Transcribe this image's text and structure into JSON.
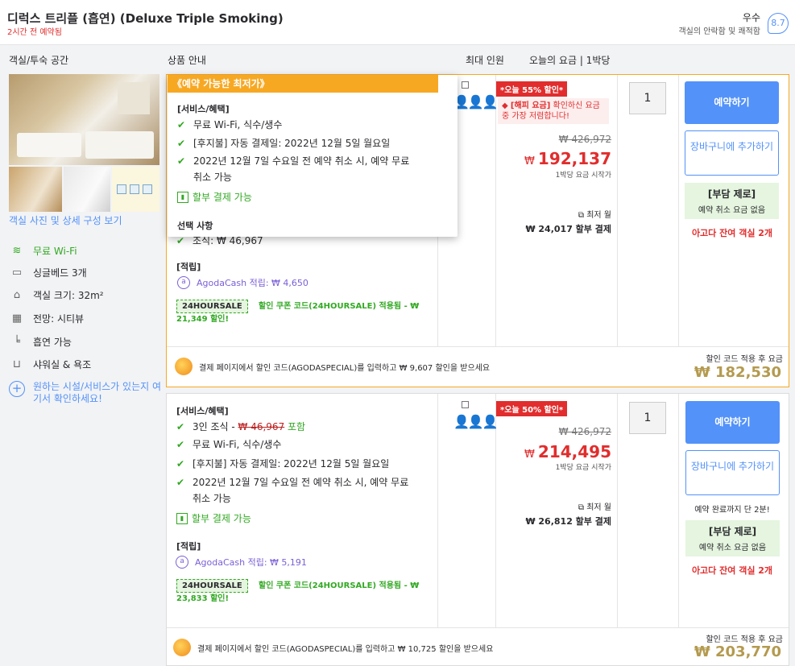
{
  "header": {
    "title": "디럭스 트리플 (흡연) (Deluxe Triple Smoking)",
    "booked_ago": "2시간 전 예약됨",
    "rating_word": "우수",
    "rating_sub": "객실의 안락함 및 쾌적함",
    "rating_score": "8.7"
  },
  "columns": {
    "room": "객실/투숙 공간",
    "info": "상품 안내",
    "occupancy": "최대 인원",
    "price": "오늘의 요금 | 1박당"
  },
  "left": {
    "photo_link": "객실 사진 및 상세 구성 보기",
    "amenities": [
      {
        "icon": "wifi-icon",
        "label": "무료 Wi-Fi"
      },
      {
        "icon": "bed-icon",
        "label": "싱글베드 3개"
      },
      {
        "icon": "room-size-icon",
        "label": "객실 크기: 32m²"
      },
      {
        "icon": "city-view-icon",
        "label": "전망: 시티뷰"
      },
      {
        "icon": "smoking-icon",
        "label": "흡연 가능"
      },
      {
        "icon": "bath-icon",
        "label": "샤워실 & 욕조"
      }
    ],
    "more_link": "원하는 시설/서비스가 있는지 여기서 확인하세요!"
  },
  "offer1": {
    "popover_title": "《예약 가능한 최저가》",
    "benefits_label": "[서비스/혜택]",
    "benefits": [
      "무료 Wi-Fi, 식수/생수",
      "[후지불] 자동 결제일: 2022년 12월 5일 월요일",
      "2022년 12월 7일 수요일 전 예약 취소 시, 예약 무료 취소 가능"
    ],
    "installment": "할부 결제 가능",
    "options_label": "선택 사항",
    "option_breakfast": "조식: ₩ 46,967",
    "points_label": "[적립]",
    "agodacash": "AgodaCash 적립: ₩ 4,650",
    "coupon_code": "24HOURSALE",
    "coupon_desc": "할인 쿠폰 코드(24HOURSALE) 적용됨 - ₩ 21,349 할인!",
    "deal_badge": "*오늘 55% 할인*",
    "hot_line1": "[해피 요금]",
    "hot_line2": " 확인하신 요금 중 가장 저렴합니다!",
    "orig_price": "₩ 426,972",
    "currency": "₩",
    "price": "192,137",
    "per_night": "1박당 요금 시작가",
    "lowest_label": "최저 월",
    "lowest_value": "₩ 24,017 할부 결제",
    "qty": "1",
    "book": "예약하기",
    "cart": "장바구니에 추가하기",
    "nodep_title": "[부담 제로]",
    "nodep_sub": "예약 취소 요금 없음",
    "rooms_left": "아고다 잔여 객실 2개",
    "promo_text": "결제 페이지에서 할인 코드(AGODASPECIAL)를 입력하고 ₩ 9,607 할인을 받으세요",
    "promo_label": "할인 코드 적용 후 요금",
    "promo_price": "₩ 182,530"
  },
  "offer2": {
    "benefits_label": "[서비스/혜택]",
    "breakfast_prefix": "3인 조식 - ",
    "breakfast_strike": "₩ 46,967",
    "breakfast_included": " 포함",
    "benefits": [
      "무료 Wi-Fi, 식수/생수",
      "[후지불] 자동 결제일: 2022년 12월 5일 월요일",
      "2022년 12월 7일 수요일 전 예약 취소 시, 예약 무료 취소 가능"
    ],
    "installment": "할부 결제 가능",
    "points_label": "[적립]",
    "agodacash": "AgodaCash 적립: ₩ 5,191",
    "coupon_code": "24HOURSALE",
    "coupon_desc": "할인 쿠폰 코드(24HOURSALE) 적용됨 - ₩ 23,833 할인!",
    "deal_badge": "*오늘 50% 할인*",
    "orig_price": "₩ 426,972",
    "currency": "₩",
    "price": "214,495",
    "per_night": "1박당 요금 시작가",
    "lowest_label": "최저 월",
    "lowest_value": "₩ 26,812 할부 결제",
    "qty": "1",
    "book": "예약하기",
    "cart": "장바구니에 추가하기",
    "finish_note": "예약 완료까지 단 2분!",
    "nodep_title": "[부담 제로]",
    "nodep_sub": "예약 취소 요금 없음",
    "rooms_left": "아고다 잔여 객실 2개",
    "promo_text": "결제 페이지에서 할인 코드(AGODASPECIAL)를 입력하고 ₩ 10,725 할인을 받으세요",
    "promo_label": "할인 코드 적용 후 요금",
    "promo_price": "₩ 203,770"
  },
  "colors": {
    "accent": "#5392f9",
    "deal": "#e12d2d",
    "green": "#32a923",
    "popover": "#f7a823",
    "promo": "#b49a4f"
  }
}
